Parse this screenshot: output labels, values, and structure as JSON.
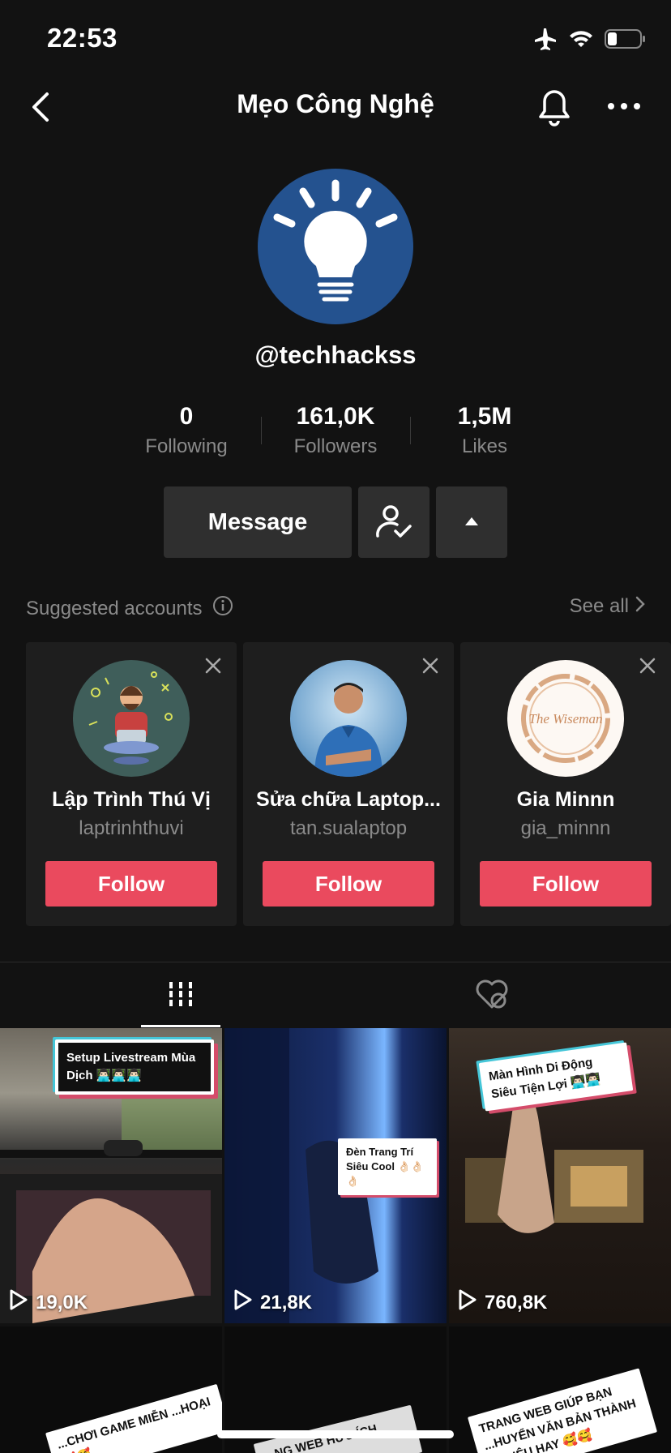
{
  "status_bar": {
    "time": "22:53",
    "icons": [
      "airplane-icon",
      "wifi-icon",
      "battery-icon"
    ]
  },
  "nav": {
    "title": "Mẹo Công Nghệ",
    "icons": [
      "back-chevron-icon",
      "bell-icon",
      "more-icon"
    ]
  },
  "profile": {
    "avatar_icon": "lightbulb-icon",
    "username": "@techhackss",
    "stats": [
      {
        "value": "0",
        "label": "Following"
      },
      {
        "value": "161,0K",
        "label": "Followers"
      },
      {
        "value": "1,5M",
        "label": "Likes"
      }
    ],
    "message_label": "Message"
  },
  "suggested": {
    "title": "Suggested accounts",
    "see_all": "See all",
    "follow_label": "Follow",
    "accounts": [
      {
        "name": "Lập Trình Thú Vị",
        "handle": "laptrinhthuvi"
      },
      {
        "name": "Sửa chữa Laptop...",
        "handle": "tan.sualaptop"
      },
      {
        "name": "Gia Minnn",
        "handle": "gia_minnn",
        "avatar_text": "The Wiseman"
      }
    ]
  },
  "videos": [
    {
      "views": "19,0K",
      "caption": "Setup Livestream Mùa Dịch 👨🏻‍💻👨🏻‍💻👨🏻‍💻"
    },
    {
      "views": "21,8K",
      "caption": "Đèn Trang Trí Siêu Cool 👌🏻👌🏻👌🏻"
    },
    {
      "views": "760,8K",
      "caption": "Màn Hình Di Động Siêu Tiện Lợi 👨🏻‍💻👨🏻‍💻"
    },
    {
      "views": "",
      "caption": "...CHƠI GAME MIỄN ...HOẠI 🥰🥰"
    },
    {
      "views": "",
      "caption": "...NG WEB HỮU ÍCH ...ỬA BIẾT"
    },
    {
      "views": "",
      "caption": "TRANG WEB GIÚP BẠN ...HUYỂN VĂN BẢN THÀNH ...I SIÊU HAY 🥰🥰"
    }
  ],
  "colors": {
    "background": "#121212",
    "follow_button": "#ea4a5e",
    "avatar_bg": "#24528f"
  }
}
